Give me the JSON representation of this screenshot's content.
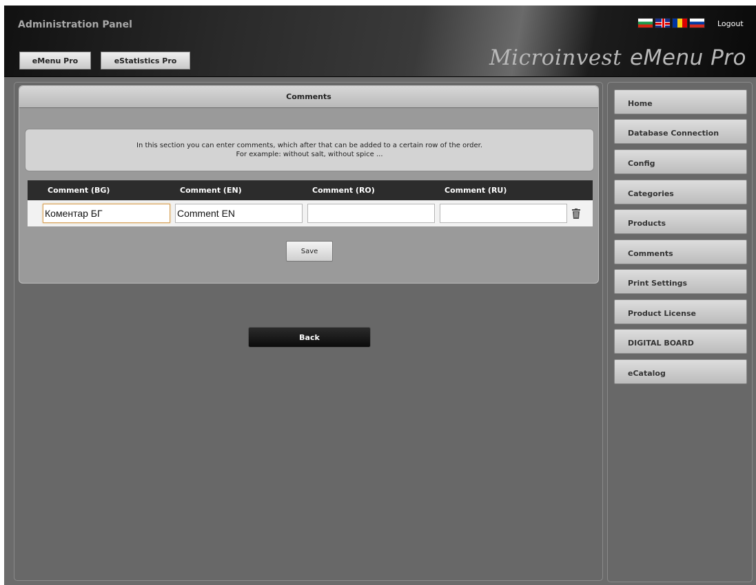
{
  "header": {
    "title": "Administration Panel",
    "tabs": [
      "eMenu Pro",
      "eStatistics Pro"
    ],
    "brand_part1": "Microinvest",
    "brand_part2": "eMenu Pro",
    "logout": "Logout",
    "flags": [
      "flag-bulgaria",
      "flag-uk",
      "flag-romania",
      "flag-russia"
    ]
  },
  "panel": {
    "title": "Comments",
    "info_line1": "In this section you can enter comments, which after that can be added to a certain row of the order.",
    "info_line2": "For example: without salt, without spice ...",
    "columns": [
      "Comment (BG)",
      "Comment (EN)",
      "Comment (RO)",
      "Comment (RU)"
    ],
    "row": {
      "bg": "Коментар БГ",
      "en": "Comment EN",
      "ro": "",
      "ru": ""
    },
    "save_label": "Save"
  },
  "back_label": "Back",
  "sidebar": {
    "items": [
      {
        "label": "Home"
      },
      {
        "label": "Database Connection"
      },
      {
        "label": "Config"
      },
      {
        "label": "Categories"
      },
      {
        "label": "Products"
      },
      {
        "label": "Comments"
      },
      {
        "label": "Print Settings"
      },
      {
        "label": "Product License"
      },
      {
        "label": "DIGITAL BOARD"
      },
      {
        "label": "eCatalog"
      }
    ]
  },
  "colors": {
    "background": "#6b6b6b",
    "header_dark": "#111111",
    "accent_focus": "#d8a25a"
  }
}
